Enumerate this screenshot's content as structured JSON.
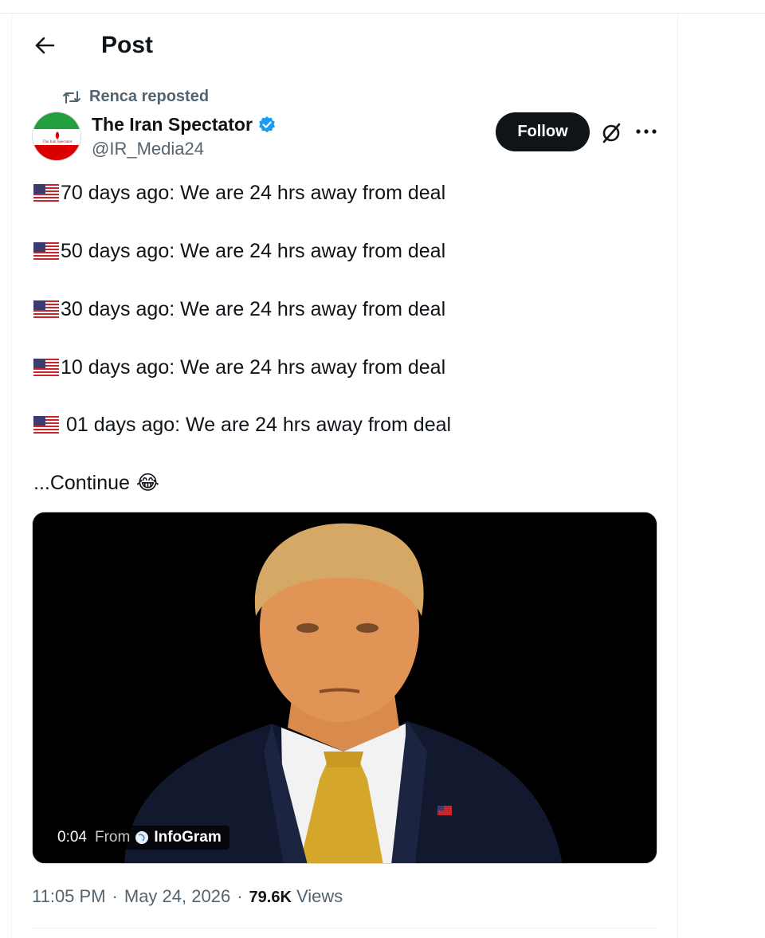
{
  "header": {
    "title": "Post"
  },
  "repost": {
    "label": "Renca reposted"
  },
  "author": {
    "name": "The Iran Spectator",
    "handle": "@IR_Media24",
    "avatar_text": "The Iran Spectator",
    "verified": true
  },
  "actions": {
    "follow_label": "Follow",
    "more_label": "···"
  },
  "tweet": {
    "lines": [
      "70 days ago: We are 24 hrs away from deal",
      "50 days ago: We are 24 hrs away from deal",
      "30 days ago: We are 24 hrs away from deal",
      "10 days ago: We are 24 hrs away from deal",
      " 01 days ago: We are 24 hrs away from deal"
    ],
    "continue_text": "...Continue",
    "continue_emoji": "😂"
  },
  "media": {
    "duration": "0:04",
    "from_label": "From",
    "source": "InfoGram"
  },
  "meta": {
    "time": "11:05 PM",
    "separator": "·",
    "date": "May 24, 2026",
    "views_count": "79.6K",
    "views_label": "Views"
  },
  "colors": {
    "text": "#0f1419",
    "secondary": "#536471",
    "verified": "#1d9bf0",
    "follow_bg": "#0f1419"
  }
}
